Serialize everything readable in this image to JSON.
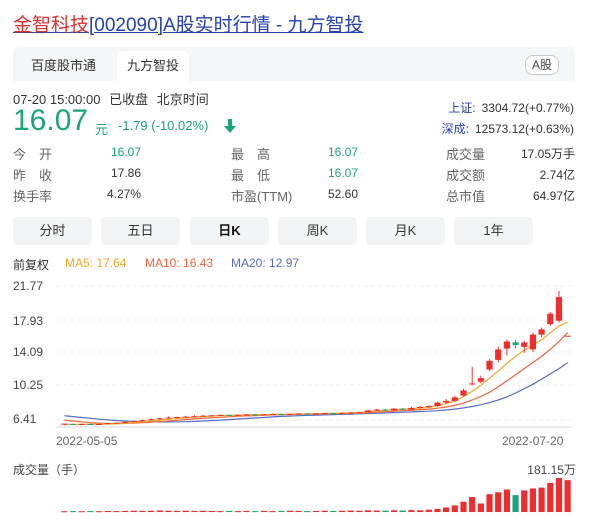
{
  "title": {
    "name": "金智科技",
    "code": "[002090]",
    "rest": "A股实时行情 - 九方智投"
  },
  "tabs": [
    "百度股市通",
    "九方智投"
  ],
  "badge": "A股",
  "status": {
    "time": "07-20 15:00:00",
    "state": "已收盘",
    "zone": "北京时间"
  },
  "price": {
    "value": "16.07",
    "unit": "元",
    "change": "-1.79 (-10.02%)"
  },
  "indices": [
    {
      "name": "上证:",
      "value": "3304.72(+0.77%)"
    },
    {
      "name": "深成:",
      "value": "12573.12(+0.63%)"
    }
  ],
  "stats": [
    {
      "label": "今　开",
      "value": "16.07",
      "color": "green"
    },
    {
      "label": "昨　收",
      "value": "17.86",
      "color": "dark"
    },
    {
      "label": "换手率",
      "value": "4.27%",
      "color": "dark"
    },
    {
      "label": "最　高",
      "value": "16.07",
      "color": "green"
    },
    {
      "label": "最　低",
      "value": "16.07",
      "color": "green"
    },
    {
      "label": "市盈(TTM)",
      "value": "52.60",
      "color": "dark"
    },
    {
      "label": "成交量",
      "value": "17.05万手",
      "color": "dark"
    },
    {
      "label": "成交额",
      "value": "2.74亿",
      "color": "dark"
    },
    {
      "label": "总市值",
      "value": "64.97亿",
      "color": "dark"
    }
  ],
  "periods": [
    "分时",
    "五日",
    "日K",
    "周K",
    "月K",
    "1年"
  ],
  "active_period": "日K",
  "ma": {
    "adj": "前复权",
    "ma5": "MA5: 17.64",
    "ma10": "MA10: 16.43",
    "ma20": "MA20: 12.97",
    "colors": {
      "ma5": "#f5a623",
      "ma10": "#f0623a",
      "ma20": "#5470c6"
    }
  },
  "chart_data": {
    "type": "candlestick",
    "y_tick_labels": [
      "21.77",
      "17.93",
      "14.09",
      "10.25",
      "6.41"
    ],
    "ylim": [
      6.41,
      21.77
    ],
    "x_tick_labels": [
      "2022-05-05",
      "2022-07-20"
    ],
    "volume_label": "成交量（手）",
    "volume_max": "181.15万",
    "up_color": "#ee2e2e",
    "down_color": "#1aa67b",
    "candles": [
      [
        5.9,
        6.0,
        5.8,
        5.95
      ],
      [
        5.95,
        5.9,
        5.85,
        6.0
      ],
      [
        5.9,
        5.95,
        5.85,
        6.0
      ],
      [
        5.95,
        5.9,
        5.85,
        6.0
      ],
      [
        5.9,
        5.95,
        5.85,
        6.0
      ],
      [
        5.95,
        6.05,
        5.9,
        6.1
      ],
      [
        6.05,
        6.1,
        6.0,
        6.15
      ],
      [
        6.1,
        6.2,
        6.05,
        6.25
      ],
      [
        6.2,
        6.3,
        6.15,
        6.35
      ],
      [
        6.3,
        6.4,
        6.25,
        6.45
      ],
      [
        6.4,
        6.5,
        6.35,
        6.6
      ],
      [
        6.5,
        6.6,
        6.45,
        6.7
      ],
      [
        6.6,
        6.7,
        6.55,
        6.8
      ],
      [
        6.7,
        6.75,
        6.6,
        6.8
      ],
      [
        6.75,
        6.8,
        6.7,
        6.9
      ],
      [
        6.8,
        6.85,
        6.75,
        6.95
      ],
      [
        6.85,
        6.9,
        6.8,
        7.0
      ],
      [
        6.9,
        6.95,
        6.85,
        7.0
      ],
      [
        6.95,
        7.0,
        6.9,
        7.05
      ],
      [
        7.0,
        6.95,
        6.9,
        7.05
      ],
      [
        6.95,
        7.0,
        6.9,
        7.05
      ],
      [
        7.0,
        7.05,
        6.95,
        7.1
      ],
      [
        7.05,
        7.0,
        6.95,
        7.1
      ],
      [
        7.0,
        7.05,
        6.95,
        7.1
      ],
      [
        7.05,
        7.1,
        7.0,
        7.15
      ],
      [
        7.1,
        7.05,
        7.0,
        7.15
      ],
      [
        7.05,
        7.1,
        7.0,
        7.15
      ],
      [
        7.1,
        7.15,
        7.05,
        7.2
      ],
      [
        7.15,
        7.1,
        7.05,
        7.2
      ],
      [
        7.1,
        7.15,
        7.05,
        7.2
      ],
      [
        7.15,
        7.2,
        7.1,
        7.25
      ],
      [
        7.2,
        7.15,
        7.1,
        7.25
      ],
      [
        7.15,
        7.2,
        7.1,
        7.3
      ],
      [
        7.2,
        7.25,
        7.15,
        7.3
      ],
      [
        7.25,
        7.3,
        7.2,
        7.35
      ],
      [
        7.3,
        7.5,
        7.25,
        7.6
      ],
      [
        7.5,
        7.6,
        7.45,
        7.7
      ],
      [
        7.6,
        7.5,
        7.45,
        7.7
      ],
      [
        7.5,
        7.7,
        7.45,
        7.8
      ],
      [
        7.7,
        7.6,
        7.55,
        7.8
      ],
      [
        7.6,
        7.8,
        7.55,
        7.9
      ],
      [
        7.8,
        7.9,
        7.7,
        8.0
      ],
      [
        7.9,
        8.0,
        7.85,
        8.1
      ],
      [
        8.0,
        8.4,
        7.95,
        8.5
      ],
      [
        8.4,
        8.6,
        8.3,
        8.8
      ],
      [
        8.6,
        9.0,
        8.5,
        9.2
      ],
      [
        9.2,
        9.8,
        9.1,
        10.0
      ],
      [
        10.5,
        10.6,
        10.4,
        12.5
      ],
      [
        10.8,
        11.2,
        10.6,
        11.5
      ],
      [
        12.2,
        13.2,
        12.0,
        13.4
      ],
      [
        13.3,
        14.5,
        13.0,
        14.8
      ],
      [
        14.6,
        15.4,
        13.8,
        15.6
      ],
      [
        15.3,
        15.0,
        14.6,
        15.6
      ],
      [
        14.8,
        15.3,
        14.1,
        15.5
      ],
      [
        14.5,
        16.2,
        14.2,
        16.4
      ],
      [
        16.2,
        16.8,
        15.9,
        17.0
      ],
      [
        17.4,
        18.6,
        17.2,
        18.8
      ],
      [
        17.8,
        20.5,
        17.6,
        21.2
      ],
      [
        16.07,
        16.07,
        16.07,
        16.07
      ]
    ],
    "ma5": [
      5.9,
      5.92,
      5.93,
      5.93,
      5.93,
      5.95,
      6.0,
      6.05,
      6.12,
      6.2,
      6.3,
      6.4,
      6.5,
      6.58,
      6.66,
      6.74,
      6.8,
      6.85,
      6.9,
      6.94,
      6.96,
      6.98,
      7.0,
      7.02,
      7.04,
      7.06,
      7.08,
      7.1,
      7.12,
      7.14,
      7.16,
      7.18,
      7.2,
      7.22,
      7.26,
      7.34,
      7.44,
      7.52,
      7.6,
      7.66,
      7.72,
      7.78,
      7.86,
      8.05,
      8.28,
      8.6,
      9.08,
      9.7,
      10.4,
      11.2,
      12.0,
      12.9,
      13.7,
      14.4,
      15.0,
      15.6,
      16.4,
      17.2,
      17.64
    ],
    "ma10": [
      6.4,
      6.3,
      6.2,
      6.1,
      6.05,
      6.0,
      6.0,
      6.02,
      6.05,
      6.1,
      6.16,
      6.22,
      6.3,
      6.38,
      6.46,
      6.54,
      6.6,
      6.66,
      6.72,
      6.78,
      6.84,
      6.88,
      6.92,
      6.96,
      6.99,
      7.02,
      7.04,
      7.06,
      7.08,
      7.1,
      7.12,
      7.14,
      7.16,
      7.18,
      7.2,
      7.24,
      7.3,
      7.36,
      7.42,
      7.48,
      7.54,
      7.6,
      7.66,
      7.76,
      7.9,
      8.08,
      8.34,
      8.7,
      9.1,
      9.6,
      10.2,
      10.9,
      11.6,
      12.3,
      13.0,
      13.7,
      14.5,
      15.4,
      16.43
    ],
    "ma20": [
      6.9,
      6.8,
      6.7,
      6.6,
      6.5,
      6.42,
      6.35,
      6.3,
      6.26,
      6.22,
      6.2,
      6.19,
      6.19,
      6.2,
      6.22,
      6.25,
      6.3,
      6.35,
      6.4,
      6.46,
      6.52,
      6.58,
      6.64,
      6.7,
      6.76,
      6.82,
      6.86,
      6.9,
      6.94,
      6.97,
      7.0,
      7.03,
      7.06,
      7.09,
      7.12,
      7.15,
      7.18,
      7.22,
      7.26,
      7.3,
      7.34,
      7.38,
      7.42,
      7.48,
      7.56,
      7.66,
      7.8,
      7.96,
      8.16,
      8.4,
      8.7,
      9.06,
      9.5,
      10.0,
      10.5,
      11.1,
      11.7,
      12.3,
      12.97
    ],
    "volumes": [
      0.4,
      0.5,
      0.4,
      0.5,
      0.4,
      0.6,
      0.5,
      0.6,
      0.7,
      0.6,
      0.7,
      0.8,
      0.7,
      0.6,
      0.7,
      0.6,
      0.7,
      0.6,
      0.5,
      0.6,
      0.5,
      0.6,
      0.5,
      0.6,
      0.5,
      0.6,
      0.7,
      0.6,
      0.5,
      0.6,
      0.7,
      0.6,
      0.7,
      0.8,
      0.7,
      0.9,
      0.8,
      0.7,
      0.9,
      0.8,
      1.0,
      0.9,
      1.2,
      1.6,
      2.4,
      3.5,
      5.5,
      8.0,
      4.5,
      9.5,
      10.5,
      12.0,
      9.0,
      11.5,
      12.5,
      13.0,
      15.5,
      18.1,
      17.0
    ]
  }
}
